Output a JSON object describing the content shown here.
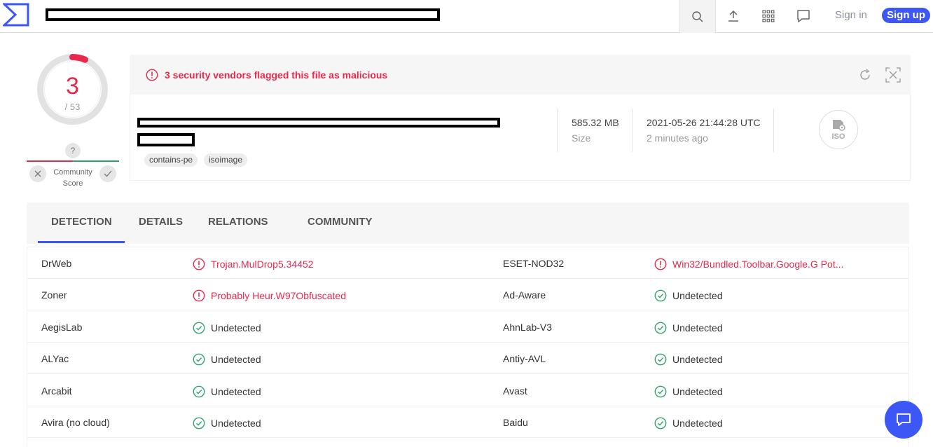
{
  "topbar": {
    "search_value": "",
    "signin_label": "Sign in",
    "signup_label": "Sign up",
    "icons": [
      "search-icon",
      "upload-icon",
      "apps-grid-icon",
      "chat-icon"
    ],
    "accent_color": "#3c57f5"
  },
  "score": {
    "detections": "3",
    "total": "/ 53",
    "community_question": "?",
    "community_label_line1": "Community",
    "community_label_line2": "Score",
    "malicious_color": "#e8294c"
  },
  "alert": {
    "message": "3 security vendors flagged this file as malicious"
  },
  "file": {
    "tags": [
      "contains-pe",
      "isoimage"
    ],
    "size_value": "585.32 MB",
    "size_label": "Size",
    "date_value": "2021-05-26 21:44:28 UTC",
    "date_relative": "2 minutes ago",
    "type_icon": "ISO"
  },
  "tabs": [
    {
      "label": "DETECTION",
      "active": true
    },
    {
      "label": "DETAILS",
      "active": false
    },
    {
      "label": "RELATIONS",
      "active": false
    },
    {
      "label": "COMMUNITY",
      "active": false
    }
  ],
  "detections": [
    {
      "left_engine": "DrWeb",
      "left_result": "Trojan.MulDrop5.34452",
      "left_status": "malicious",
      "right_engine": "ESET-NOD32",
      "right_result": "Win32/Bundled.Toolbar.Google.G Pot...",
      "right_status": "malicious"
    },
    {
      "left_engine": "Zoner",
      "left_result": "Probably Heur.W97Obfuscated",
      "left_status": "malicious",
      "right_engine": "Ad-Aware",
      "right_result": "Undetected",
      "right_status": "undetected"
    },
    {
      "left_engine": "AegisLab",
      "left_result": "Undetected",
      "left_status": "undetected",
      "right_engine": "AhnLab-V3",
      "right_result": "Undetected",
      "right_status": "undetected"
    },
    {
      "left_engine": "ALYac",
      "left_result": "Undetected",
      "left_status": "undetected",
      "right_engine": "Antiy-AVL",
      "right_result": "Undetected",
      "right_status": "undetected"
    },
    {
      "left_engine": "Arcabit",
      "left_result": "Undetected",
      "left_status": "undetected",
      "right_engine": "Avast",
      "right_result": "Undetected",
      "right_status": "undetected"
    },
    {
      "left_engine": "Avira (no cloud)",
      "left_result": "Undetected",
      "left_status": "undetected",
      "right_engine": "Baidu",
      "right_result": "Undetected",
      "right_status": "undetected"
    }
  ]
}
